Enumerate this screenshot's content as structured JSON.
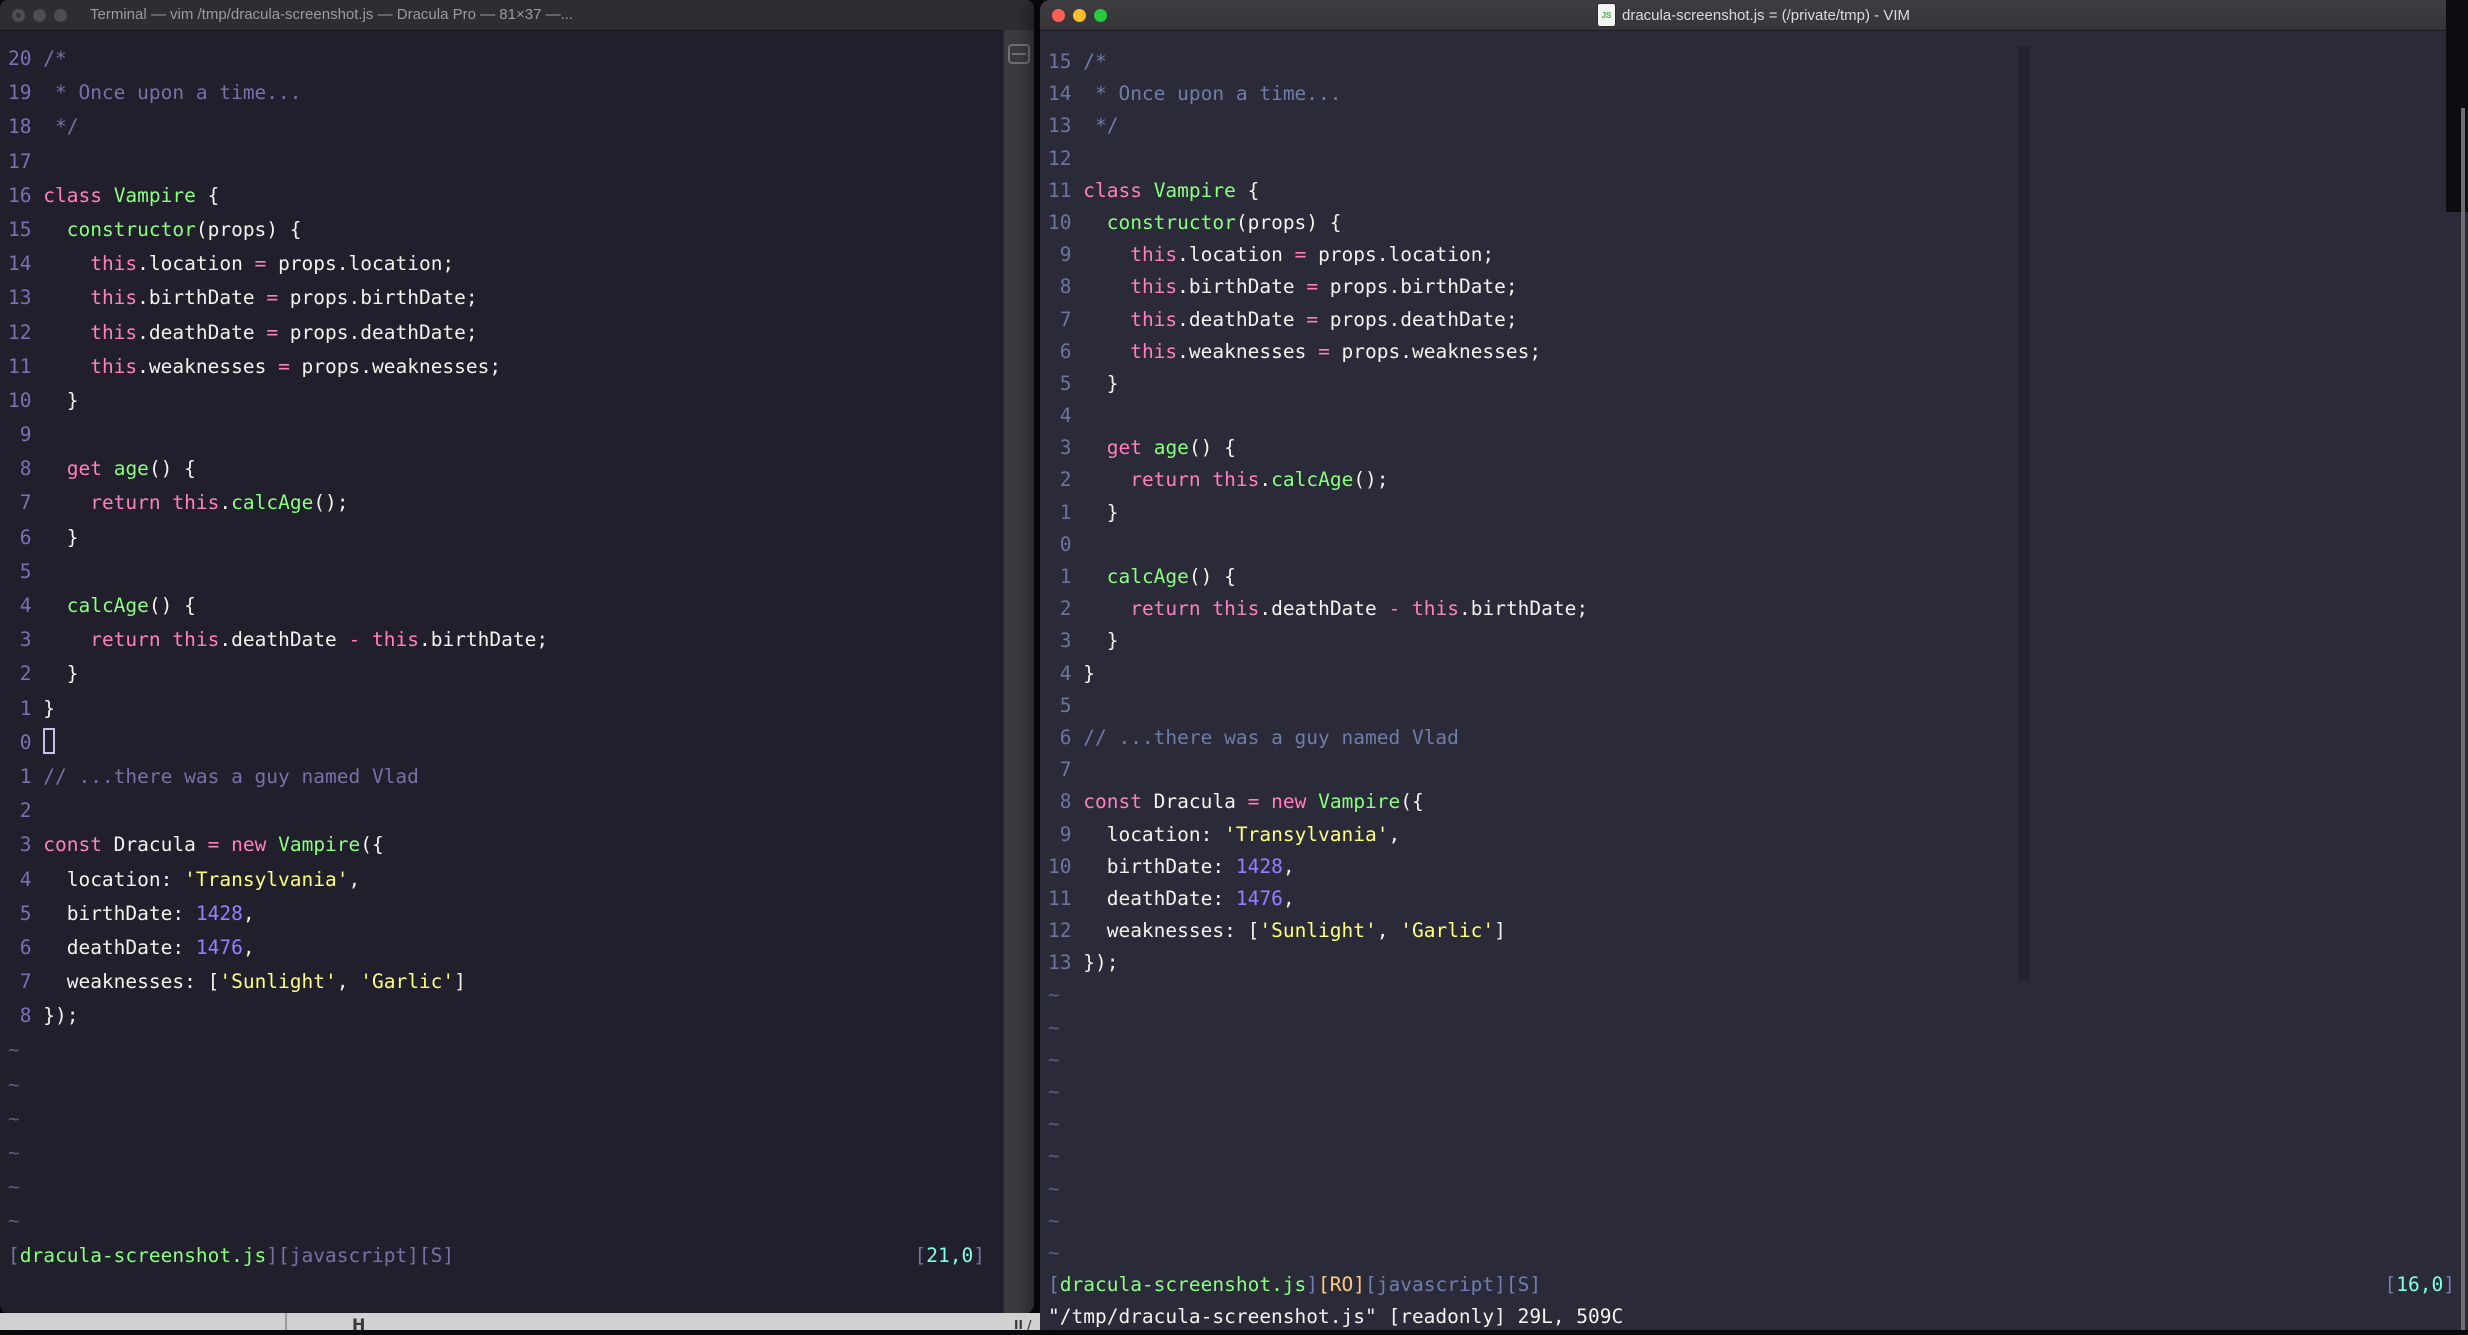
{
  "colors": {
    "fg": "#f3f2ed",
    "pink": "#ff80bf",
    "green": "#8aff80",
    "yellow": "#ffff80",
    "num_purple": "#9580ff",
    "cyan": "#80ffea",
    "orange": "#ffca80",
    "left_bg": "#201f2b",
    "right_bg": "#2a2a38",
    "left_comment": "#7970a9",
    "left_linenr": "#7b71b4",
    "left_tilde": "#5e5a7a",
    "left_bracket": "#7970a9",
    "right_comment": "#707da8",
    "right_linenr": "#6c76a0",
    "right_tilde": "#545e7e",
    "right_bracket": "#6f7db0",
    "cursor_outline": "#c9c0ee",
    "traffic_inactive": "#4f4d4f",
    "traffic_inactive_dot": "#353335",
    "traffic_red": "#ff5f57",
    "traffic_yellow": "#febc2e",
    "traffic_green": "#28c840"
  },
  "buffer": {
    "lines": [
      [
        [
          "/*",
          "c"
        ]
      ],
      [
        [
          " * Once upon a time...",
          "c"
        ]
      ],
      [
        [
          " */",
          "c"
        ]
      ],
      [],
      [
        [
          "class",
          "p"
        ],
        [
          " ",
          "f"
        ],
        [
          "Vampire",
          "g"
        ],
        [
          " {",
          "f"
        ]
      ],
      [
        [
          "  ",
          "f"
        ],
        [
          "constructor",
          "g"
        ],
        [
          "(props) {",
          "f"
        ]
      ],
      [
        [
          "    ",
          "f"
        ],
        [
          "this",
          "p"
        ],
        [
          ".location ",
          "f"
        ],
        [
          "=",
          "p"
        ],
        [
          " props.location;",
          "f"
        ]
      ],
      [
        [
          "    ",
          "f"
        ],
        [
          "this",
          "p"
        ],
        [
          ".birthDate ",
          "f"
        ],
        [
          "=",
          "p"
        ],
        [
          " props.birthDate;",
          "f"
        ]
      ],
      [
        [
          "    ",
          "f"
        ],
        [
          "this",
          "p"
        ],
        [
          ".deathDate ",
          "f"
        ],
        [
          "=",
          "p"
        ],
        [
          " props.deathDate;",
          "f"
        ]
      ],
      [
        [
          "    ",
          "f"
        ],
        [
          "this",
          "p"
        ],
        [
          ".weaknesses ",
          "f"
        ],
        [
          "=",
          "p"
        ],
        [
          " props.weaknesses;",
          "f"
        ]
      ],
      [
        [
          "  }",
          "f"
        ]
      ],
      [],
      [
        [
          "  ",
          "f"
        ],
        [
          "get",
          "p"
        ],
        [
          " ",
          "f"
        ],
        [
          "age",
          "g"
        ],
        [
          "() {",
          "f"
        ]
      ],
      [
        [
          "    ",
          "f"
        ],
        [
          "return",
          "p"
        ],
        [
          " ",
          "f"
        ],
        [
          "this",
          "p"
        ],
        [
          ".",
          "f"
        ],
        [
          "calcAge",
          "g"
        ],
        [
          "();",
          "f"
        ]
      ],
      [
        [
          "  }",
          "f"
        ]
      ],
      [],
      [
        [
          "  ",
          "f"
        ],
        [
          "calcAge",
          "g"
        ],
        [
          "() {",
          "f"
        ]
      ],
      [
        [
          "    ",
          "f"
        ],
        [
          "return",
          "p"
        ],
        [
          " ",
          "f"
        ],
        [
          "this",
          "p"
        ],
        [
          ".deathDate ",
          "f"
        ],
        [
          "-",
          "p"
        ],
        [
          " ",
          "f"
        ],
        [
          "this",
          "p"
        ],
        [
          ".birthDate;",
          "f"
        ]
      ],
      [
        [
          "  }",
          "f"
        ]
      ],
      [
        [
          "}",
          "f"
        ]
      ],
      [],
      [
        [
          "// ...there was a guy named Vlad",
          "c"
        ]
      ],
      [],
      [
        [
          "const",
          "p"
        ],
        [
          " Dracula ",
          "f"
        ],
        [
          "=",
          "p"
        ],
        [
          " ",
          "f"
        ],
        [
          "new",
          "p"
        ],
        [
          " ",
          "f"
        ],
        [
          "Vampire",
          "g"
        ],
        [
          "({",
          "f"
        ]
      ],
      [
        [
          "  location: ",
          "f"
        ],
        [
          "'Transylvania'",
          "y"
        ],
        [
          ",",
          "f"
        ]
      ],
      [
        [
          "  birthDate: ",
          "f"
        ],
        [
          "1428",
          "n"
        ],
        [
          ",",
          "f"
        ]
      ],
      [
        [
          "  deathDate: ",
          "f"
        ],
        [
          "1476",
          "n"
        ],
        [
          ",",
          "f"
        ]
      ],
      [
        [
          "  weaknesses: [",
          "f"
        ],
        [
          "'Sunlight'",
          "y"
        ],
        [
          ", ",
          "f"
        ],
        [
          "'Garlic'",
          "y"
        ],
        [
          "]",
          "f"
        ]
      ],
      [
        [
          "});",
          "f"
        ]
      ]
    ]
  },
  "left_window": {
    "title": "Terminal — vim /tmp/dracula-screenshot.js — Dracula Pro — 81×37 —...",
    "gutter": [
      "20",
      "19",
      "18",
      "17",
      "16",
      "15",
      "14",
      "13",
      "12",
      "11",
      "10",
      " 9",
      " 8",
      " 7",
      " 6",
      " 5",
      " 4",
      " 3",
      " 2",
      " 1",
      " 0",
      " 1",
      " 2",
      " 3",
      " 4",
      " 5",
      " 6",
      " 7",
      " 8"
    ],
    "cursor_line": 20,
    "cursor_style": "hollow",
    "tildes": 6,
    "status_left": [
      [
        "[",
        "sb"
      ],
      [
        "dracula-screenshot.js",
        "g"
      ],
      [
        "][javascript][S]",
        "sb"
      ]
    ],
    "status_right": [
      [
        "[",
        "sb"
      ],
      [
        "21,0",
        "cy"
      ],
      [
        "]",
        "sb"
      ]
    ],
    "command_line": ""
  },
  "right_window": {
    "title": "dracula-screenshot.js = (/private/tmp) - VIM",
    "title_icon_label": "JS",
    "gutter": [
      "15",
      "14",
      "13",
      "12",
      "11",
      "10",
      " 9",
      " 8",
      " 7",
      " 6",
      " 5",
      " 4",
      " 3",
      " 2",
      " 1",
      " 0",
      " 1",
      " 2",
      " 3",
      " 4",
      " 5",
      " 6",
      " 7",
      " 8",
      " 9",
      "10",
      "11",
      "12",
      "13"
    ],
    "cursor_line": 15,
    "cursor_style": "none",
    "tildes": 9,
    "status_left": [
      [
        "[",
        "sb"
      ],
      [
        "dracula-screenshot.js",
        "g"
      ],
      [
        "]",
        "sb"
      ],
      [
        "[RO]",
        "o"
      ],
      [
        "[javascript][S]",
        "sb"
      ]
    ],
    "status_right": [
      [
        "[",
        "sb"
      ],
      [
        "16,0",
        "cy"
      ],
      [
        "]",
        "sb"
      ]
    ],
    "message": "\"/tmp/dracula-screenshot.js\" [readonly] 29L, 509C"
  },
  "desktop": {
    "fragment_1": "H",
    "fragment_2": "II /"
  }
}
